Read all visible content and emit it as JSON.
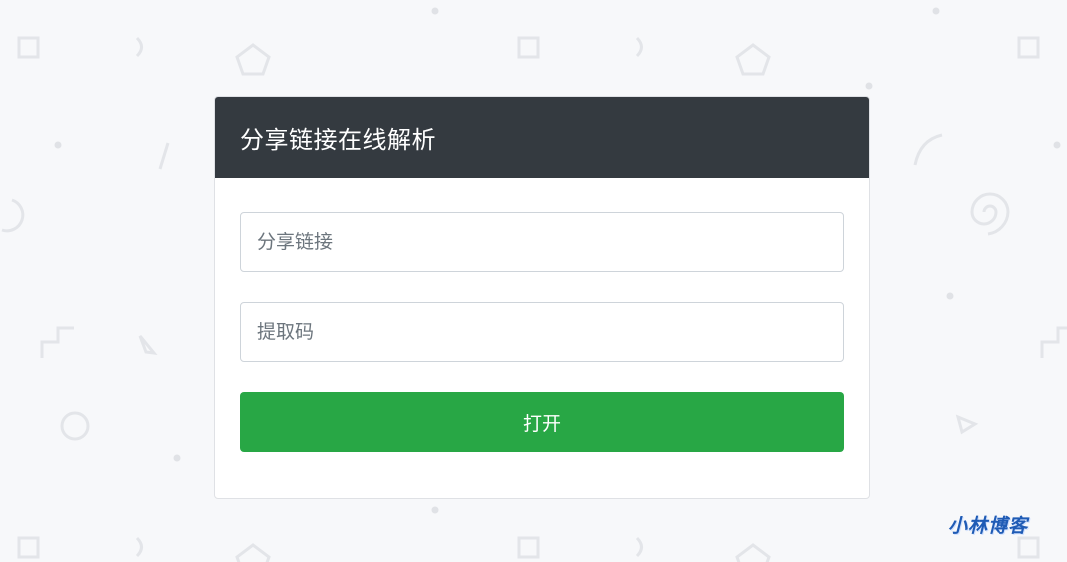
{
  "card": {
    "title": "分享链接在线解析"
  },
  "form": {
    "share_link": {
      "value": "",
      "placeholder": "分享链接"
    },
    "extract_code": {
      "value": "",
      "placeholder": "提取码"
    },
    "open_label": "打开"
  },
  "brand": {
    "logo_text": "小林博客"
  },
  "colors": {
    "header_bg": "#343a40",
    "button_bg": "#28a745",
    "page_bg": "#f7f8fa",
    "logo": "#1f5bb5"
  }
}
